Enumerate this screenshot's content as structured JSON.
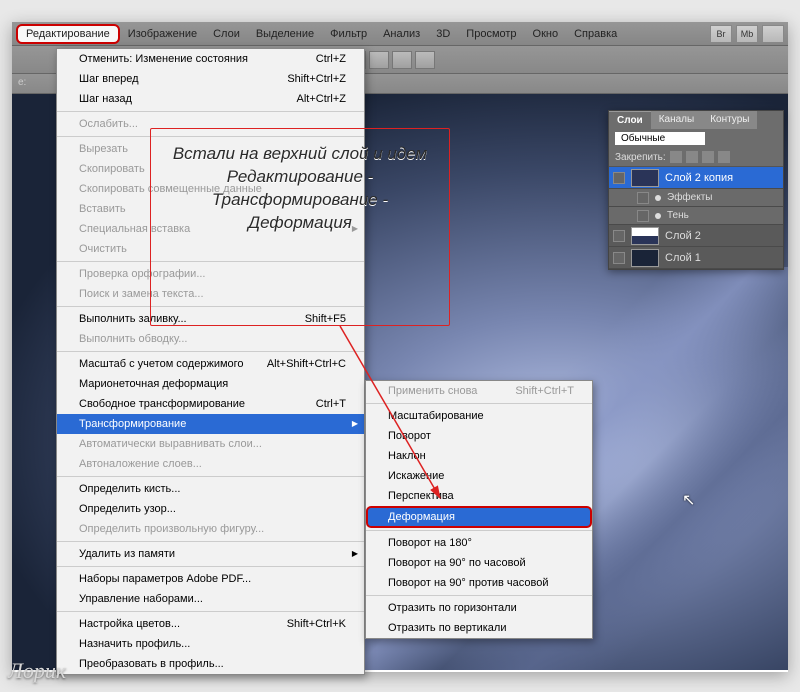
{
  "menubar": {
    "items": [
      "Редактирование",
      "Изображение",
      "Слои",
      "Выделение",
      "Фильтр",
      "Анализ",
      "3D",
      "Просмотр",
      "Окно",
      "Справка"
    ],
    "buttons": [
      "Br",
      "Mb"
    ]
  },
  "optbar_text": "e:",
  "edit_menu": {
    "undo": {
      "label": "Отменить: Изменение состояния",
      "key": "Ctrl+Z"
    },
    "step_fwd": {
      "label": "Шаг вперед",
      "key": "Shift+Ctrl+Z"
    },
    "step_back": {
      "label": "Шаг назад",
      "key": "Alt+Ctrl+Z"
    },
    "fade": {
      "label": "Ослабить..."
    },
    "cut": {
      "label": "Вырезать"
    },
    "copy": {
      "label": "Скопировать"
    },
    "copy_merged": {
      "label": "Скопировать совмещенные данные"
    },
    "paste": {
      "label": "Вставить"
    },
    "paste_special": {
      "label": "Специальная вставка"
    },
    "clear": {
      "label": "Очистить"
    },
    "spell": {
      "label": "Проверка орфографии..."
    },
    "find": {
      "label": "Поиск и замена текста..."
    },
    "fill": {
      "label": "Выполнить заливку...",
      "key": "Shift+F5"
    },
    "stroke": {
      "label": "Выполнить обводку..."
    },
    "content_scale": {
      "label": "Масштаб с учетом содержимого",
      "key": "Alt+Shift+Ctrl+C"
    },
    "puppet": {
      "label": "Марионеточная деформация"
    },
    "free_transform": {
      "label": "Свободное трансформирование",
      "key": "Ctrl+T"
    },
    "transform": {
      "label": "Трансформирование"
    },
    "auto_align": {
      "label": "Автоматически выравнивать слои..."
    },
    "auto_blend": {
      "label": "Автоналожение слоев..."
    },
    "def_brush": {
      "label": "Определить кисть..."
    },
    "def_pattern": {
      "label": "Определить узор..."
    },
    "def_shape": {
      "label": "Определить произвольную фигуру..."
    },
    "purge": {
      "label": "Удалить из памяти"
    },
    "pdf_presets": {
      "label": "Наборы параметров Adobe PDF..."
    },
    "presets": {
      "label": "Управление наборами..."
    },
    "color_set": {
      "label": "Настройка цветов...",
      "key": "Shift+Ctrl+K"
    },
    "assign_profile": {
      "label": "Назначить профиль..."
    },
    "convert_profile": {
      "label": "Преобразовать в профиль..."
    }
  },
  "transform_submenu": {
    "again": {
      "label": "Применить снова",
      "key": "Shift+Ctrl+T"
    },
    "scale": {
      "label": "Масштабирование"
    },
    "rotate": {
      "label": "Поворот"
    },
    "skew": {
      "label": "Наклон"
    },
    "distort": {
      "label": "Искажение"
    },
    "perspective": {
      "label": "Перспектива"
    },
    "warp": {
      "label": "Деформация"
    },
    "r180": {
      "label": "Поворот на 180°"
    },
    "r90cw": {
      "label": "Поворот на 90° по часовой"
    },
    "r90ccw": {
      "label": "Поворот на 90° против часовой"
    },
    "flip_h": {
      "label": "Отразить по горизонтали"
    },
    "flip_v": {
      "label": "Отразить по вертикали"
    }
  },
  "layers_panel": {
    "tabs": [
      "Слои",
      "Каналы",
      "Контуры"
    ],
    "mode": "Обычные",
    "lock_label": "Закрепить:",
    "layers": [
      {
        "name": "Слой 2 копия",
        "selected": true
      },
      {
        "name": "Эффекты",
        "fx": true,
        "sub": true
      },
      {
        "name": "Тень",
        "sub": true
      },
      {
        "name": "Слой 2"
      },
      {
        "name": "Слой 1"
      }
    ]
  },
  "callout_text": "Встали на верхний слой и идем Редактирование - Трансформирование - Деформация",
  "watermark": "Лорик"
}
